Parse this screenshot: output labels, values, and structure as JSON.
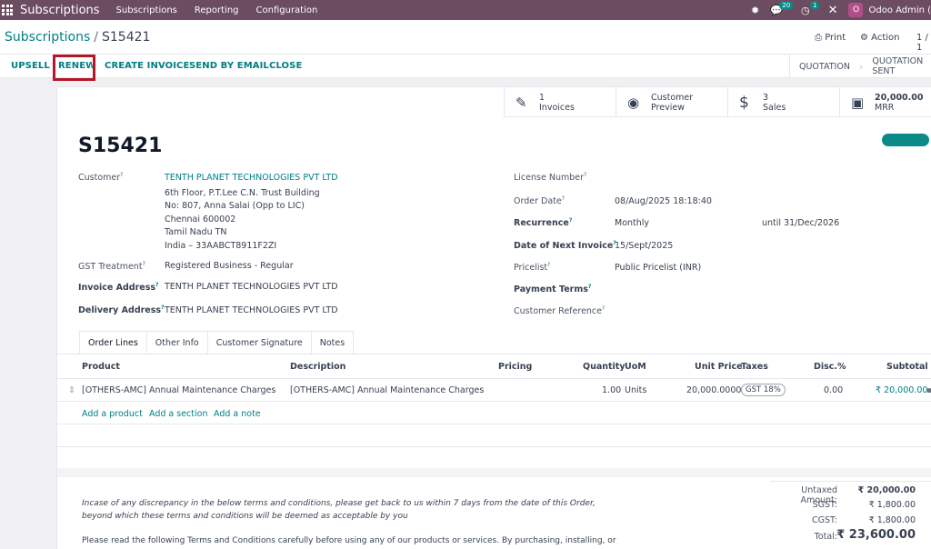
{
  "nav": {
    "brand": "Subscriptions",
    "items": [
      "Subscriptions",
      "Reporting",
      "Configuration"
    ],
    "messages_badge": "20",
    "activity_badge": "1",
    "avatar_letter": "O",
    "user": "Odoo Admin (v"
  },
  "breadcrumb": {
    "parent": "Subscriptions",
    "current": "S15421"
  },
  "control": {
    "print": "Print",
    "action": "Action",
    "pager": "1 / 1"
  },
  "buttons": {
    "upsell": "UPSELL",
    "renew": "RENEW",
    "create_invoice": "CREATE INVOICE",
    "send_email": "SEND BY EMAIL",
    "close": "CLOSE"
  },
  "status": [
    "QUOTATION",
    "QUOTATION SENT"
  ],
  "smart_buttons": [
    {
      "line1": "1",
      "line2": "Invoices",
      "icon": "pencil-square-icon"
    },
    {
      "line1": "Customer",
      "line2": "Preview",
      "icon": "globe-icon"
    },
    {
      "line1": "3",
      "line2": "Sales",
      "icon": "dollar-icon"
    },
    {
      "line1": "20,000.00",
      "line2": "MRR",
      "icon": "money-icon"
    }
  ],
  "record": {
    "name": "S15421",
    "customer_label": "Customer",
    "customer": "TENTH PLANET TECHNOLOGIES PVT LTD",
    "address": [
      "6th Floor, P.T.Lee C.N. Trust Building",
      "No: 807, Anna Salai (Opp to LIC)",
      "Chennai 600002",
      "Tamil Nadu TN",
      "India – 33AABCT8911F2ZI"
    ],
    "gst_label": "GST Treatment",
    "gst": "Registered Business - Regular",
    "invoice_addr_label": "Invoice Address",
    "invoice_addr": "TENTH PLANET TECHNOLOGIES PVT LTD",
    "delivery_addr_label": "Delivery Address",
    "delivery_addr": "TENTH PLANET TECHNOLOGIES PVT LTD",
    "license_label": "License Number",
    "order_date_label": "Order Date",
    "order_date": "08/Aug/2025 18:18:40",
    "recurrence_label": "Recurrence",
    "recurrence": "Monthly",
    "until": "until 31/Dec/2026",
    "next_invoice_label": "Date of Next Invoice",
    "next_invoice": "15/Sept/2025",
    "pricelist_label": "Pricelist",
    "pricelist": "Public Pricelist (INR)",
    "payment_terms_label": "Payment Terms",
    "customer_ref_label": "Customer Reference"
  },
  "tabs": [
    "Order Lines",
    "Other Info",
    "Customer Signature",
    "Notes"
  ],
  "table": {
    "headers": {
      "product": "Product",
      "description": "Description",
      "pricing": "Pricing",
      "quantity": "Quantity",
      "uom": "UoM",
      "unit_price": "Unit Price",
      "taxes": "Taxes",
      "disc": "Disc.%",
      "subtotal": "Subtotal"
    },
    "row": {
      "product": "[OTHERS-AMC] Annual Maintenance Charges",
      "description": "[OTHERS-AMC] Annual Maintenance Charges",
      "quantity": "1.00",
      "uom": "Units",
      "unit_price": "20,000.0000",
      "tax": "GST 18%",
      "disc": "0.00",
      "subtotal": "₹ 20,000.00"
    },
    "links": {
      "add_product": "Add a product",
      "add_section": "Add a section",
      "add_note": "Add a note"
    }
  },
  "terms": {
    "italic": "Incase of any discrepancy in the below terms and conditions, please get back to us within 7 days from the date of this Order, beyond which these terms and conditions will be deemed as acceptable by you",
    "plain": "Please read the following Terms and Conditions carefully before using any of our products or services. By purchasing, installing, or"
  },
  "totals": {
    "untaxed_label": "Untaxed Amount:",
    "untaxed": "₹ 20,000.00",
    "sgst_label": "SGST:",
    "sgst": "₹ 1,800.00",
    "cgst_label": "CGST:",
    "cgst": "₹ 1,800.00",
    "total_label": "Total:",
    "total": "₹ 23,600.00"
  }
}
